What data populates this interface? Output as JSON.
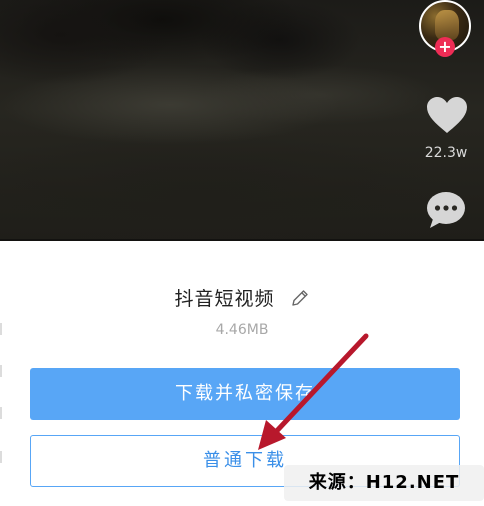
{
  "video": {
    "like_count": "22.3w",
    "follow_symbol": "+"
  },
  "icons": {
    "like": "heart-icon",
    "comment": "comment-icon",
    "edit": "pencil-icon"
  },
  "sheet": {
    "title": "抖音短视频",
    "file_size": "4.46MB",
    "primary_button": "下载并私密保存",
    "secondary_button": "普通下载"
  },
  "watermark": "来源：H12.NET",
  "colors": {
    "primary": "#58a6f6",
    "follow": "#ee2c55",
    "arrow": "#b8182c"
  }
}
